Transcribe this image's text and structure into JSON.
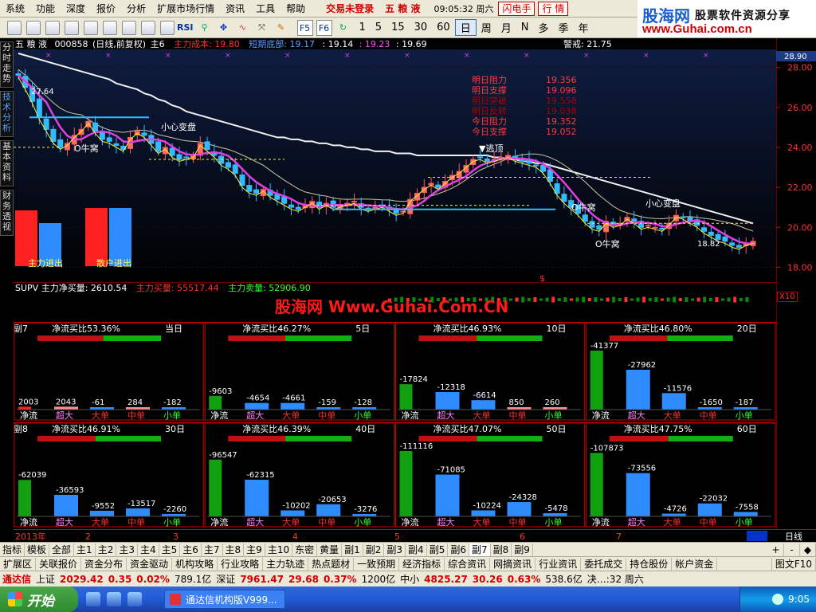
{
  "menubar": {
    "items": [
      "系统",
      "功能",
      "深度",
      "报价",
      "分析",
      "扩展市场行情",
      "资讯",
      "工具",
      "帮助"
    ],
    "login_status": "交易未登录",
    "stock_name": "五 粮 液",
    "time": "09:05:32 周六",
    "flash_button": "闪电手",
    "quote_button": "行 情"
  },
  "logo": {
    "brand": "股海网",
    "tagline": "股票软件资源分享",
    "url": "www.Guhai.com.cn"
  },
  "toolbar": {
    "periods": [
      "1",
      "5",
      "15",
      "30",
      "60",
      "日",
      "周",
      "月",
      "N",
      "多",
      "季",
      "年"
    ],
    "active_period": "日",
    "icons": [
      "arrow-left-icon",
      "rsi-icon",
      "zoom-icon",
      "pan-icon",
      "line-chart-icon",
      "arrow-cross-icon",
      "draw-line-icon",
      "pencil-icon",
      "refresh-icon",
      "f5-icon",
      "f6-icon"
    ],
    "rsi_label": "RSI",
    "f5_label": "F5",
    "f6_label": "F6"
  },
  "sidetabs": [
    "分时走势",
    "技术分析",
    "基本资料",
    "财务透视"
  ],
  "main_chart": {
    "header": {
      "name": "五 粮 液",
      "code": "000858",
      "mode": "(日线,前复权)",
      "indicator": "主6",
      "cost_label": "主力成本: 19.80",
      "bottom_label": "短期底部: 19.17",
      "val1": ": 19.14",
      "val2": ": 19.23",
      "val3": ": 19.69",
      "warning": "警戒: 21.75"
    },
    "annotations": {
      "high_label": "27.64",
      "low_label": "18.82",
      "careful1": "小心变盘",
      "careful2": "小心变盘",
      "cow_nest1": "O牛窝",
      "cow_nest2": "O牛窝",
      "cow_nest3": "O牛窝",
      "escape": "▼逃顶",
      "dollar": "$",
      "main_inout": "主力进出",
      "retail_inout": "散户进出"
    },
    "levels": [
      {
        "label": "明日阻力",
        "value": "19.356",
        "color": "#ff3b3b"
      },
      {
        "label": "明日支撑",
        "value": "19.096",
        "color": "#ff3b3b"
      },
      {
        "label": "明日突破",
        "value": "19.558",
        "color": "#b00000"
      },
      {
        "label": "明日反转",
        "value": "19.038",
        "color": "#b00000"
      },
      {
        "label": "今日阻力",
        "value": "19.352",
        "color": "#ff3b3b"
      },
      {
        "label": "今日支撑",
        "value": "19.052",
        "color": "#ff3b3b"
      }
    ]
  },
  "right_axis": {
    "top_value": "28.90",
    "ticks": [
      "28.00",
      "26.00",
      "24.00",
      "22.00",
      "20.00",
      "18.00"
    ]
  },
  "supv": {
    "title": "SUPV 主力净买量: 2610.54",
    "buy": "主力买量: 55517.44",
    "sell": "主力卖量: 52906.90",
    "x10": "X10"
  },
  "watermark": "股海网 Www.Guhai.Com.CN",
  "panel7": {
    "title": "副7",
    "blocks": [
      {
        "ratio": "净流买比53.36%",
        "period": "当日",
        "labels": [
          "2003",
          "2043",
          "-61",
          "284",
          "-182"
        ]
      },
      {
        "ratio": "净流买比46.27%",
        "period": "5日",
        "labels": [
          "-9603",
          "-4654",
          "-4661",
          "-159",
          "-128"
        ]
      },
      {
        "ratio": "净流买比46.93%",
        "period": "10日",
        "labels": [
          "-17824",
          "-12318",
          "-6614",
          "850",
          "260"
        ]
      },
      {
        "ratio": "净流买比46.80%",
        "period": "20日",
        "labels": [
          "-41377",
          "-27962",
          "-11576",
          "-1650",
          "-187"
        ]
      }
    ],
    "categories": [
      "净流",
      "超大",
      "大单",
      "中单",
      "小单"
    ]
  },
  "panel8": {
    "title": "副8",
    "blocks": [
      {
        "ratio": "净流买比46.91%",
        "period": "30日",
        "labels": [
          "-62039",
          "-36593",
          "-9552",
          "-13517",
          "-2260"
        ]
      },
      {
        "ratio": "净流买比46.39%",
        "period": "40日",
        "labels": [
          "-96547",
          "-62315",
          "-10202",
          "-20653",
          "-3276"
        ]
      },
      {
        "ratio": "净流买比47.07%",
        "period": "50日",
        "labels": [
          "-111116",
          "-71085",
          "-10224",
          "-24328",
          "-5478"
        ]
      },
      {
        "ratio": "净流买比47.75%",
        "period": "60日",
        "labels": [
          "-107873",
          "-73556",
          "-4726",
          "-22032",
          "-7558"
        ]
      }
    ],
    "categories": [
      "净流",
      "超大",
      "大单",
      "中单",
      "小单"
    ]
  },
  "timeline": {
    "year": "2013年",
    "months": [
      "2",
      "3",
      "4",
      "5",
      "6",
      "7"
    ],
    "right_label": "日线"
  },
  "bottom_tabs": {
    "items": [
      "指标",
      "模板",
      "全部",
      "主1",
      "主2",
      "主3",
      "主4",
      "主5",
      "主6",
      "主7",
      "主8",
      "主9",
      "主10",
      "东密",
      "黄量",
      "副1",
      "副2",
      "副3",
      "副4",
      "副5",
      "副6",
      "副7",
      "副8",
      "副9"
    ],
    "active": "副7",
    "controls": [
      "+",
      "-",
      "◆"
    ]
  },
  "nav_tabs": {
    "items": [
      "扩展区",
      "关联报价",
      "资金分布",
      "资金驱动",
      "机构攻略",
      "行业攻略",
      "主力轨迹",
      "热点题材",
      "一致预期",
      "经济指标",
      "综合资讯",
      "网摘资讯",
      "行业资讯",
      "委托成交",
      "持仓股份",
      "帐户资金"
    ],
    "right": "图文F10"
  },
  "quote_bar": {
    "app": "通达信",
    "sh_label": "上证",
    "sh_value": "2029.42",
    "sh_change": "0.35",
    "sh_pct": "0.02%",
    "sh_amount": "789.1亿",
    "sz_label": "深证",
    "sz_value": "7961.47",
    "sz_change": "29.68",
    "sz_pct": "0.37%",
    "sz_amount": "1200亿",
    "zx_label": "中小",
    "zx_value": "4825.27",
    "zx_change": "30.26",
    "zx_pct": "0.63%",
    "zx_amount": "538.6亿",
    "tail": "决…:32 周六"
  },
  "taskbar": {
    "start": "开始",
    "task": "通达信机构版V999...",
    "clock": "9:05"
  },
  "chart_data": {
    "type": "candlestick",
    "ylim": [
      17.5,
      28.9
    ],
    "price_ticks": [
      28.0,
      26.0,
      24.0,
      22.0,
      20.0,
      18.0
    ],
    "close": [
      27.6,
      27.0,
      26.3,
      25.5,
      24.9,
      24.3,
      24.0,
      24.2,
      24.6,
      24.9,
      25.3,
      24.8,
      24.4,
      24.3,
      24.1,
      23.9,
      24.5,
      24.8,
      24.6,
      24.2,
      23.8,
      24.0,
      23.6,
      23.4,
      23.5,
      23.6,
      24.2,
      23.9,
      23.6,
      23.2,
      23.0,
      22.7,
      22.1,
      21.8,
      21.7,
      21.9,
      21.6,
      21.4,
      21.2,
      21.0,
      20.9,
      21.1,
      21.3,
      21.0,
      21.2,
      21.0,
      21.1,
      21.2,
      21.3,
      21.0,
      20.9,
      21.0,
      21.1,
      20.9,
      20.7,
      20.8,
      21.4,
      21.7,
      22.0,
      22.2,
      22.0,
      22.3,
      22.6,
      22.8,
      23.1,
      23.4,
      23.5,
      23.3,
      23.4,
      23.5,
      23.6,
      23.4,
      23.3,
      23.2,
      23.1,
      22.8,
      22.3,
      21.7,
      21.3,
      21.0,
      20.7,
      20.3,
      20.0,
      19.9,
      20.3,
      20.1,
      20.2,
      20.5,
      20.3,
      20.0,
      20.1,
      20.0,
      19.9,
      20.2,
      20.6,
      20.5,
      20.3,
      20.1,
      19.8,
      19.6,
      19.4,
      19.3,
      19.1,
      19.0,
      19.2,
      19.3
    ],
    "ma_long": [
      28.7,
      28.6,
      28.5,
      28.4,
      28.3,
      28.2,
      28.1,
      28.0,
      27.9,
      27.8,
      27.7,
      27.6,
      27.5,
      27.4,
      27.2,
      27.1,
      27.0,
      26.9,
      26.7,
      26.6,
      26.4,
      26.3,
      26.1,
      26.0,
      25.8,
      25.7,
      25.6,
      25.5,
      25.4,
      25.3,
      25.2,
      25.1,
      25.0,
      24.9,
      24.8,
      24.7,
      24.6,
      24.5,
      24.5,
      24.4,
      24.4,
      24.3,
      24.3,
      24.2,
      24.2,
      24.1,
      24.1,
      24.0,
      24.0,
      23.9,
      23.9,
      23.8,
      23.8,
      23.8,
      23.7,
      23.7,
      23.7,
      23.6,
      23.6,
      23.6,
      23.6,
      23.6,
      23.6,
      23.6,
      23.6,
      23.6,
      23.6,
      23.6,
      23.5,
      23.5,
      23.4,
      23.4,
      23.3,
      23.3,
      23.2,
      23.2,
      23.1,
      23.0,
      22.9,
      22.8,
      22.7,
      22.6,
      22.5,
      22.4,
      22.3,
      22.2,
      22.1,
      22.0,
      21.9,
      21.8,
      21.7,
      21.6,
      21.5,
      21.4,
      21.3,
      21.2,
      21.1,
      21.0,
      20.9,
      20.8,
      20.7,
      20.6,
      20.5,
      20.4,
      20.3,
      20.2
    ],
    "panel7_values": [
      [
        2003,
        2043,
        -61,
        284,
        -182
      ],
      [
        -9603,
        -4654,
        -4661,
        -159,
        -128
      ],
      [
        -17824,
        -12318,
        -6614,
        850,
        260
      ],
      [
        -41377,
        -27962,
        -11576,
        -1650,
        -187
      ]
    ],
    "panel8_values": [
      [
        -62039,
        -36593,
        -9552,
        -13517,
        -2260
      ],
      [
        -96547,
        -62315,
        -10202,
        -20653,
        -3276
      ],
      [
        -111116,
        -71085,
        -10224,
        -24328,
        -5478
      ],
      [
        -107873,
        -73556,
        -4726,
        -22032,
        -7558
      ]
    ],
    "panel7_ratios": [
      53.36,
      46.27,
      46.93,
      46.8
    ],
    "panel8_ratios": [
      46.91,
      46.39,
      47.07,
      47.75
    ]
  }
}
